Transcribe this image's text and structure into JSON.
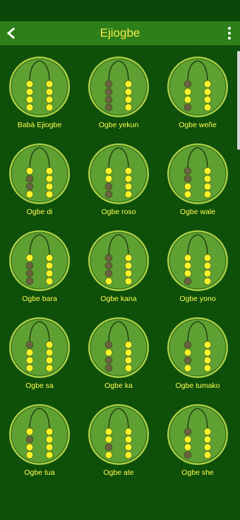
{
  "app": {
    "title": "Ejiogbe"
  },
  "icons": {
    "back": "back-arrow-icon",
    "menu": "more-vert-icon"
  },
  "colors": {
    "appbar": "#2d7f19",
    "background": "#0e4f0a",
    "title": "#f5e94a",
    "medal_outer": "#a9cf45",
    "medal_inner": "#5fa033",
    "dot_open": "#f8f22a",
    "dot_closed": "#6a6340"
  },
  "odu": [
    {
      "label": "Babà Ejiogbe",
      "left": [
        1,
        1,
        1,
        1
      ],
      "right": [
        1,
        1,
        1,
        1
      ]
    },
    {
      "label": "Ogbe yekun",
      "left": [
        0,
        0,
        0,
        0
      ],
      "right": [
        1,
        1,
        1,
        1
      ]
    },
    {
      "label": "Ogbe weñe",
      "left": [
        0,
        1,
        1,
        0
      ],
      "right": [
        1,
        1,
        1,
        1
      ]
    },
    {
      "label": "Ogbe di",
      "left": [
        1,
        0,
        0,
        1
      ],
      "right": [
        1,
        1,
        1,
        1
      ]
    },
    {
      "label": "Ogbe roso",
      "left": [
        1,
        1,
        0,
        0
      ],
      "right": [
        1,
        1,
        1,
        1
      ]
    },
    {
      "label": "Ogbe wale",
      "left": [
        0,
        0,
        1,
        1
      ],
      "right": [
        1,
        1,
        1,
        1
      ]
    },
    {
      "label": "Ogbe bara",
      "left": [
        1,
        0,
        0,
        0
      ],
      "right": [
        1,
        1,
        1,
        1
      ]
    },
    {
      "label": "Ogbe kana",
      "left": [
        0,
        0,
        0,
        1
      ],
      "right": [
        1,
        1,
        1,
        1
      ]
    },
    {
      "label": "Ogbe yono",
      "left": [
        1,
        1,
        1,
        0
      ],
      "right": [
        1,
        1,
        1,
        1
      ]
    },
    {
      "label": "Ogbe sa",
      "left": [
        0,
        1,
        1,
        1
      ],
      "right": [
        1,
        1,
        1,
        1
      ]
    },
    {
      "label": "Ogbe ka",
      "left": [
        0,
        1,
        0,
        0
      ],
      "right": [
        1,
        1,
        1,
        1
      ]
    },
    {
      "label": "Ogbe tumako",
      "left": [
        0,
        1,
        0,
        1
      ],
      "right": [
        1,
        1,
        1,
        1
      ]
    },
    {
      "label": "Ogbe tua",
      "left": [
        1,
        0,
        1,
        1
      ],
      "right": [
        1,
        1,
        1,
        1
      ]
    },
    {
      "label": "Ogbe ate",
      "left": [
        1,
        1,
        0,
        1
      ],
      "right": [
        1,
        1,
        1,
        1
      ]
    },
    {
      "label": "Ogbe she",
      "left": [
        0,
        1,
        1,
        0
      ],
      "right": [
        1,
        1,
        1,
        1
      ]
    }
  ]
}
